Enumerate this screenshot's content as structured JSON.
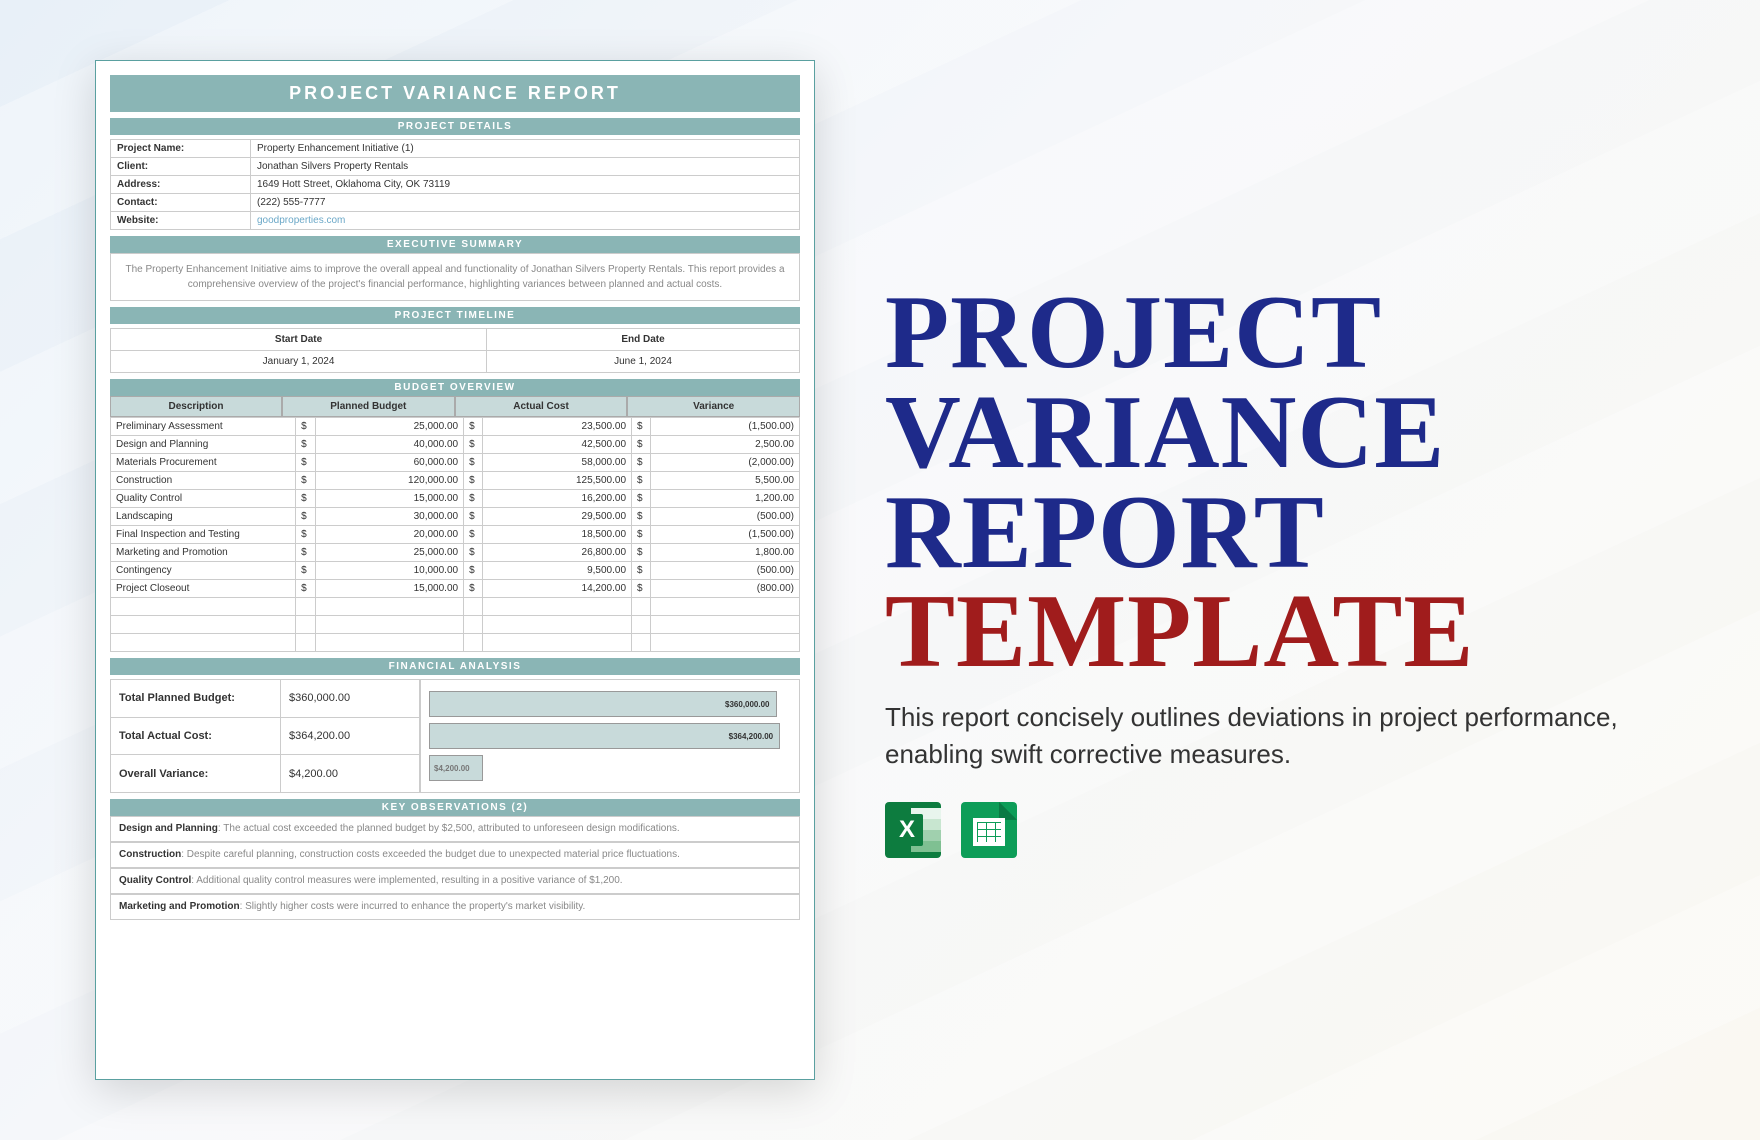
{
  "doc": {
    "title": "PROJECT VARIANCE REPORT",
    "sections": {
      "details": "PROJECT DETAILS",
      "summary": "EXECUTIVE SUMMARY",
      "timeline": "PROJECT TIMELINE",
      "budget": "BUDGET OVERVIEW",
      "financial": "FINANCIAL ANALYSIS",
      "observations": "KEY OBSERVATIONS (2)"
    },
    "details": {
      "project_name_label": "Project Name:",
      "project_name": "Property Enhancement Initiative (1)",
      "client_label": "Client:",
      "client": "Jonathan Silvers Property Rentals",
      "address_label": "Address:",
      "address": "1649 Hott Street, Oklahoma City, OK 73119",
      "contact_label": "Contact:",
      "contact": "(222) 555-7777",
      "website_label": "Website:",
      "website": "goodproperties.com"
    },
    "summary_text": "The Property Enhancement Initiative aims to improve the overall appeal and functionality of Jonathan Silvers Property Rentals. This report provides a comprehensive overview of the project's financial performance, highlighting variances between planned and actual costs.",
    "timeline": {
      "start_label": "Start Date",
      "end_label": "End Date",
      "start": "January 1, 2024",
      "end": "June 1, 2024"
    },
    "budget": {
      "headers": {
        "desc": "Description",
        "planned": "Planned Budget",
        "actual": "Actual Cost",
        "variance": "Variance"
      },
      "rows": [
        {
          "desc": "Preliminary Assessment",
          "planned": "25,000.00",
          "actual": "23,500.00",
          "variance": "(1,500.00)"
        },
        {
          "desc": "Design and Planning",
          "planned": "40,000.00",
          "actual": "42,500.00",
          "variance": "2,500.00"
        },
        {
          "desc": "Materials Procurement",
          "planned": "60,000.00",
          "actual": "58,000.00",
          "variance": "(2,000.00)"
        },
        {
          "desc": "Construction",
          "planned": "120,000.00",
          "actual": "125,500.00",
          "variance": "5,500.00"
        },
        {
          "desc": "Quality Control",
          "planned": "15,000.00",
          "actual": "16,200.00",
          "variance": "1,200.00"
        },
        {
          "desc": "Landscaping",
          "planned": "30,000.00",
          "actual": "29,500.00",
          "variance": "(500.00)"
        },
        {
          "desc": "Final Inspection and Testing",
          "planned": "20,000.00",
          "actual": "18,500.00",
          "variance": "(1,500.00)"
        },
        {
          "desc": "Marketing and Promotion",
          "planned": "25,000.00",
          "actual": "26,800.00",
          "variance": "1,800.00"
        },
        {
          "desc": "Contingency",
          "planned": "10,000.00",
          "actual": "9,500.00",
          "variance": "(500.00)"
        },
        {
          "desc": "Project Closeout",
          "planned": "15,000.00",
          "actual": "14,200.00",
          "variance": "(800.00)"
        }
      ]
    },
    "financial": {
      "planned_label": "Total Planned Budget:",
      "planned": "$360,000.00",
      "actual_label": "Total Actual Cost:",
      "actual": "$364,200.00",
      "variance_label": "Overall Variance:",
      "variance": "$4,200.00",
      "bar_planned": "$360,000.00",
      "bar_actual": "$364,200.00",
      "bar_variance": "$4,200.00"
    },
    "observations": [
      {
        "bold": "Design and Planning",
        "text": ": The actual cost exceeded the planned budget by $2,500, attributed to unforeseen design modifications."
      },
      {
        "bold": "Construction",
        "text": ": Despite careful planning, construction costs exceeded the budget due to unexpected material price fluctuations."
      },
      {
        "bold": "Quality Control",
        "text": ": Additional quality control measures were implemented, resulting in a positive variance of $1,200."
      },
      {
        "bold": "Marketing and Promotion",
        "text": ": Slightly higher costs were incurred to enhance the property's market visibility."
      }
    ]
  },
  "side": {
    "line1": "PROJECT",
    "line2": "VARIANCE",
    "line3": "REPORT",
    "line4": "TEMPLATE",
    "desc": "This report concisely outlines deviations in project performance, enabling swift corrective measures."
  },
  "chart_data": {
    "type": "bar",
    "orientation": "horizontal",
    "title": "Financial Analysis",
    "categories": [
      "Total Planned Budget",
      "Total Actual Cost",
      "Overall Variance"
    ],
    "values": [
      360000.0,
      364200.0,
      4200.0
    ],
    "xlabel": "USD",
    "xlim": [
      0,
      370000
    ]
  }
}
